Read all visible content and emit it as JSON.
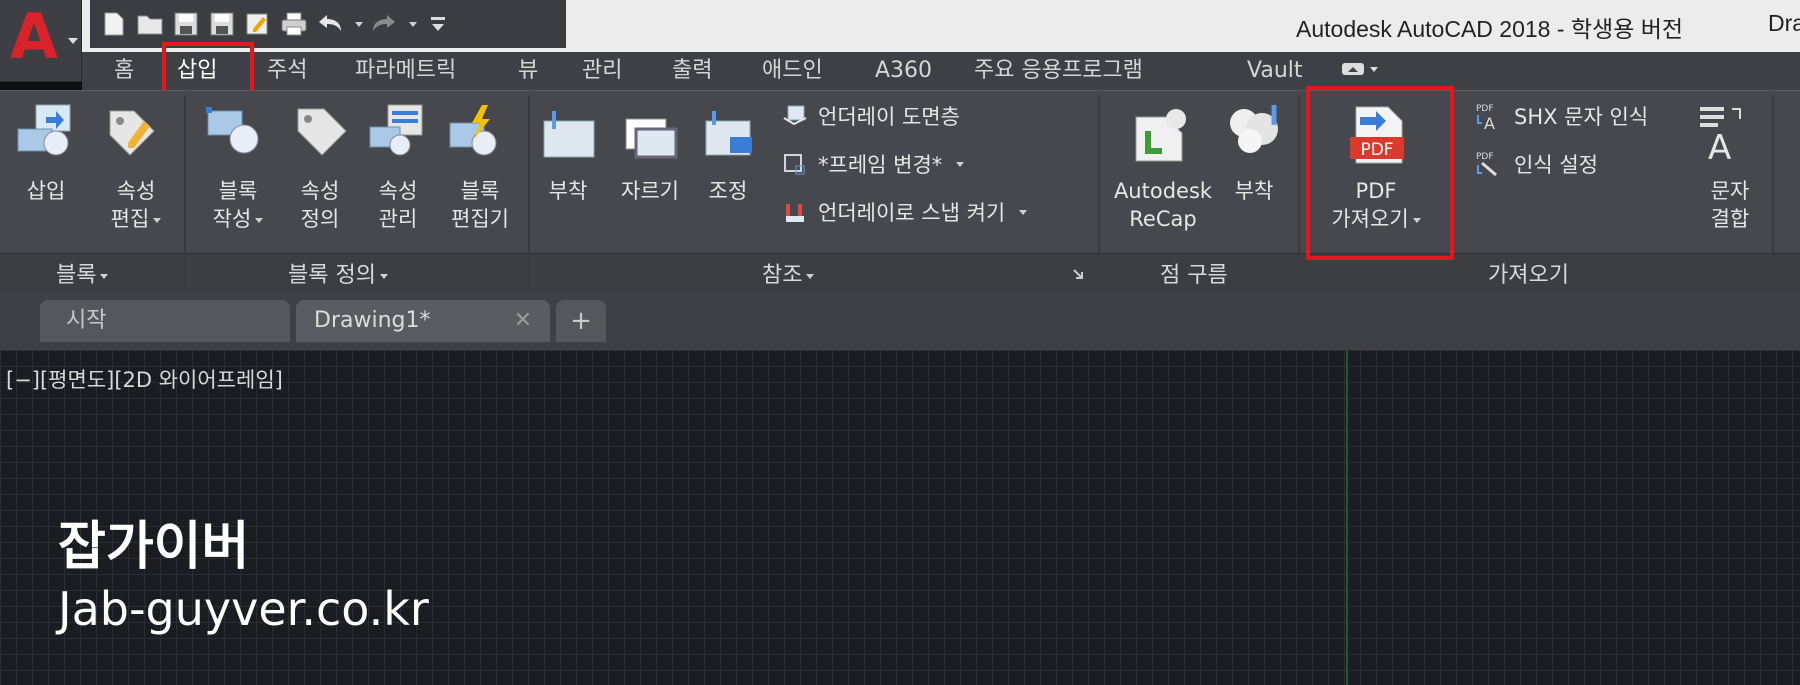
{
  "title_bar": {
    "window_title": "Autodesk AutoCAD 2018 - 학생용 버전",
    "window_title_extra": "Dra",
    "app_button_letter": "A",
    "quick_access": [
      "new-icon",
      "open-icon",
      "save-icon",
      "save-as-icon",
      "edit-icon",
      "print-icon",
      "undo-icon",
      "redo-icon",
      "customize-icon"
    ]
  },
  "ribbon_tabs": [
    {
      "label": "홈"
    },
    {
      "label": "삽입"
    },
    {
      "label": "주석"
    },
    {
      "label": "파라메트릭"
    },
    {
      "label": "뷰"
    },
    {
      "label": "관리"
    },
    {
      "label": "출력"
    },
    {
      "label": "애드인"
    },
    {
      "label": "A360"
    },
    {
      "label": "주요 응용프로그램"
    },
    {
      "label": "Vault"
    }
  ],
  "active_tab": "삽입",
  "panels": {
    "block": {
      "title": "블록",
      "buttons": [
        {
          "label_1": "삽입",
          "label_2": ""
        },
        {
          "label_1": "속성",
          "label_2": "편집"
        }
      ]
    },
    "block_def": {
      "title": "블록 정의",
      "buttons": [
        {
          "label_1": "블록",
          "label_2": "작성"
        },
        {
          "label_1": "속성",
          "label_2": "정의"
        },
        {
          "label_1": "속성",
          "label_2": "관리"
        },
        {
          "label_1": "블록",
          "label_2": "편집기"
        }
      ]
    },
    "reference": {
      "title": "참조",
      "buttons": [
        {
          "label": "부착"
        },
        {
          "label": "자르기"
        },
        {
          "label": "조정"
        }
      ],
      "small_items": [
        {
          "label": "언더레이 도면층"
        },
        {
          "label": "*프레임 변경*"
        },
        {
          "label": "언더레이로 스냅 켜기"
        }
      ]
    },
    "point_cloud": {
      "title": "점 구름",
      "buttons": [
        {
          "label_1": "Autodesk",
          "label_2": "ReCap"
        },
        {
          "label_1": "부착",
          "label_2": ""
        }
      ]
    },
    "import": {
      "title": "가져오기",
      "pdf_button": {
        "label_1": "PDF",
        "label_2": "가져오기",
        "icon_text": "PDF"
      },
      "small_items": [
        {
          "label": "SHX 문자 인식"
        },
        {
          "label": "인식 설정"
        }
      ],
      "text_combine": {
        "label_1": "문자",
        "label_2": "결합"
      }
    }
  },
  "document_tabs": [
    {
      "label": "시작"
    },
    {
      "label": "Drawing1*"
    }
  ],
  "viewport_label": "[−][평면도][2D 와이어프레임]",
  "watermark": {
    "line1": "잡가이버",
    "line2": "Jab-guyver.co.kr"
  },
  "colors": {
    "highlight": "#e5161c",
    "logo": "#d8232a",
    "ribbon_bg": "#46484d",
    "canvas_bg": "#1a1c21"
  }
}
